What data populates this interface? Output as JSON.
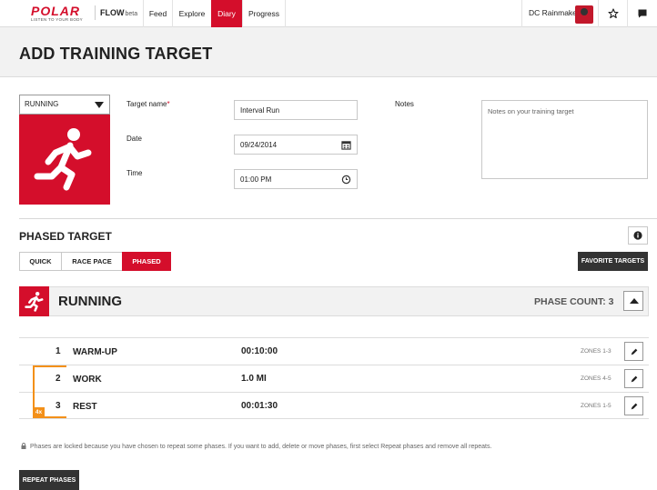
{
  "nav": {
    "brand": "POLAR",
    "tagline": "LISTEN TO YOUR BODY",
    "product": "FLOW",
    "product_badge": "beta",
    "items": [
      {
        "label": "Feed",
        "active": false
      },
      {
        "label": "Explore",
        "active": false
      },
      {
        "label": "Diary",
        "active": true
      },
      {
        "label": "Progress",
        "active": false
      }
    ],
    "user_name": "DC Rainmaker",
    "icons": [
      "star-icon",
      "message-icon"
    ]
  },
  "page": {
    "title": "ADD TRAINING TARGET"
  },
  "sport_select": {
    "value": "RUNNING",
    "icon": "runner-icon"
  },
  "form": {
    "target_name_label": "Target name",
    "required_marker": "*",
    "target_name_value": "Interval Run",
    "date_label": "Date",
    "date_value": "09/24/2014",
    "time_label": "Time",
    "time_value": "01:00 PM",
    "notes_label": "Notes",
    "notes_placeholder": "Notes on your training target"
  },
  "phased": {
    "title": "PHASED TARGET",
    "tabs": [
      {
        "label": "QUICK",
        "active": false
      },
      {
        "label": "RACE PACE",
        "active": false
      },
      {
        "label": "PHASED",
        "active": true
      }
    ],
    "favorites_button": "FAVORITE TARGETS",
    "sport_name": "RUNNING",
    "phase_count_text": "PHASE COUNT: 3",
    "repeat_badge": "4x",
    "phases": [
      {
        "num": "1",
        "name": "WARM-UP",
        "value": "00:10:00",
        "zones": "ZONES 1-3"
      },
      {
        "num": "2",
        "name": "WORK",
        "value": "1.0 MI",
        "zones": "ZONES 4-5"
      },
      {
        "num": "3",
        "name": "REST",
        "value": "00:01:30",
        "zones": "ZONES 1-5"
      }
    ],
    "lock_note": "Phases are locked because you have chosen to repeat some phases. If you want to add, delete or move phases, first select Repeat phases and remove all repeats.",
    "repeat_button": "REPEAT PHASES"
  },
  "colors": {
    "accent": "#d40e2b",
    "repeat": "#f39019",
    "dark_button": "#333333"
  }
}
